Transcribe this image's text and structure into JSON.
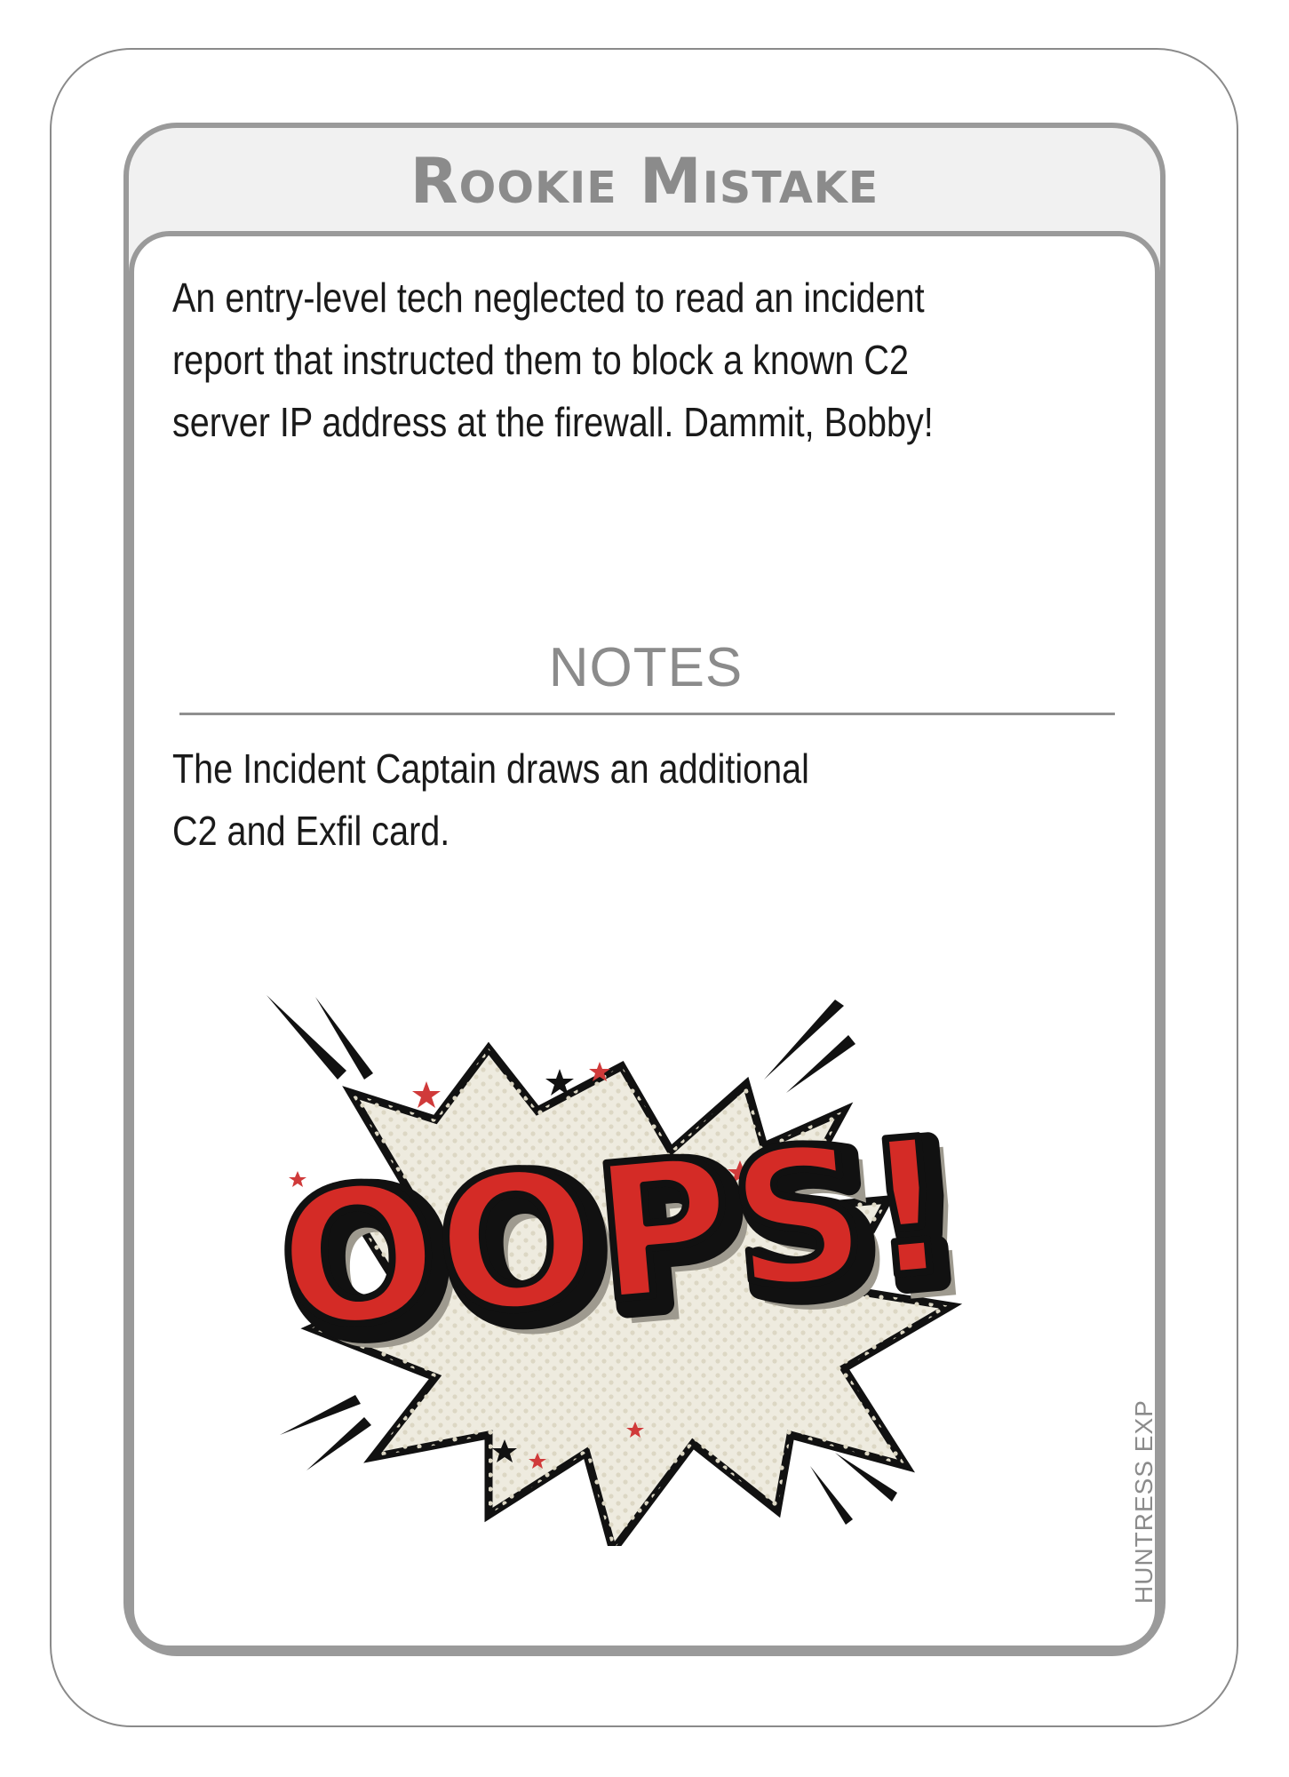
{
  "card": {
    "title": "Rookie Mistake",
    "flavor_lines": [
      "An entry-level tech neglected to read an incident",
      "report that instructed them to block a known C2",
      "server IP address at the firewall. Dammit, Bobby!"
    ],
    "notes_heading": "NOTES",
    "effect_lines": [
      "The Incident Captain draws an additional",
      "C2 and Exfil card."
    ],
    "art_text": "OOPS!",
    "set_code": "HUNTRESS EXP"
  },
  "colors": {
    "frame_gray": "#9a9a9a",
    "title_gray": "#8b8b8b",
    "burst_cream": "#eeebdf",
    "oops_red": "#d42b26",
    "star_red": "#d03a3a",
    "ink": "#111111"
  }
}
